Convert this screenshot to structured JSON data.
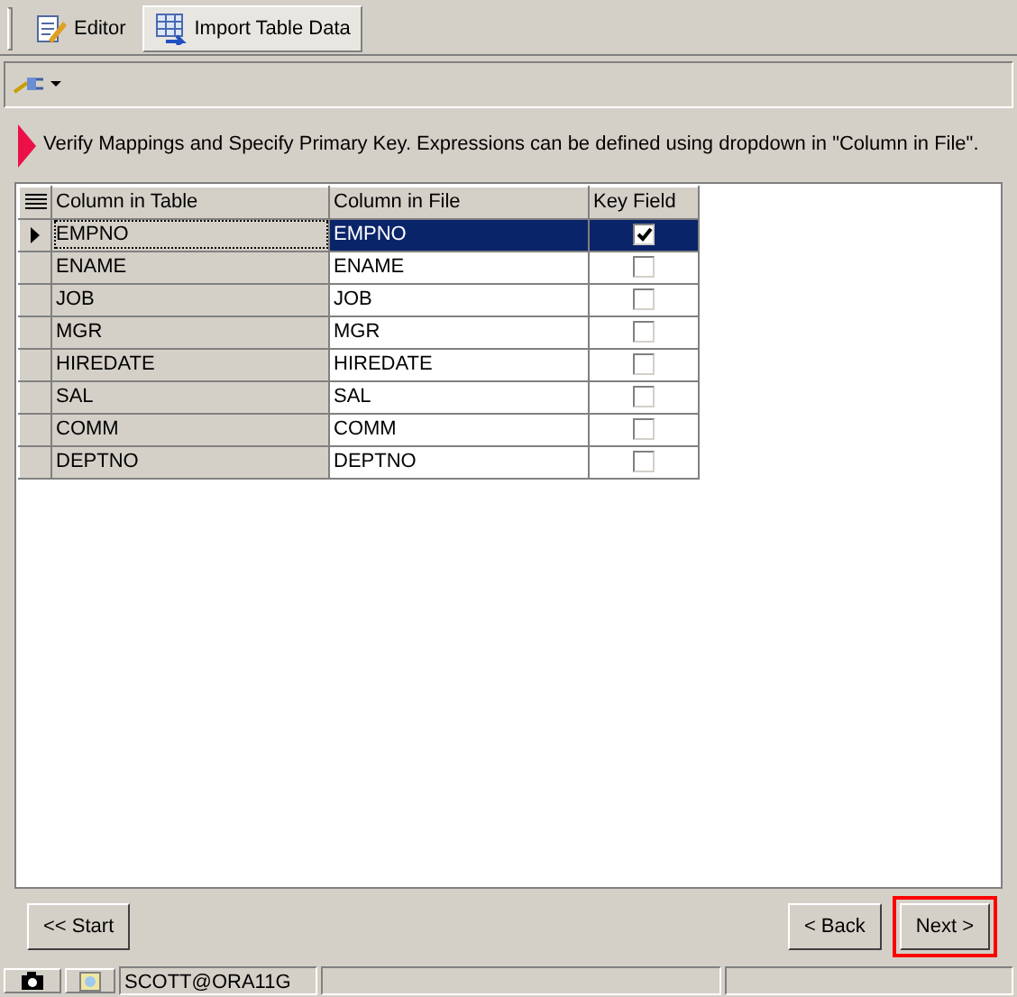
{
  "tabs": [
    {
      "label": "Editor",
      "selected": false
    },
    {
      "label": "Import Table Data",
      "selected": true
    }
  ],
  "message": "Verify Mappings and Specify Primary Key.  Expressions can be defined using dropdown in \"Column in File\".",
  "grid": {
    "columns": [
      "Column in Table",
      "Column in File",
      "Key Field"
    ],
    "rows": [
      {
        "column_in_table": "EMPNO",
        "column_in_file": "EMPNO",
        "key_field": true,
        "selected": true
      },
      {
        "column_in_table": "ENAME",
        "column_in_file": "ENAME",
        "key_field": false,
        "selected": false
      },
      {
        "column_in_table": "JOB",
        "column_in_file": "JOB",
        "key_field": false,
        "selected": false
      },
      {
        "column_in_table": "MGR",
        "column_in_file": "MGR",
        "key_field": false,
        "selected": false
      },
      {
        "column_in_table": "HIREDATE",
        "column_in_file": "HIREDATE",
        "key_field": false,
        "selected": false
      },
      {
        "column_in_table": "SAL",
        "column_in_file": "SAL",
        "key_field": false,
        "selected": false
      },
      {
        "column_in_table": "COMM",
        "column_in_file": "COMM",
        "key_field": false,
        "selected": false
      },
      {
        "column_in_table": "DEPTNO",
        "column_in_file": "DEPTNO",
        "key_field": false,
        "selected": false
      }
    ]
  },
  "buttons": [
    {
      "label": "<< Start",
      "highlighted": false
    },
    {
      "label": "< Back",
      "highlighted": false
    },
    {
      "label": "Next >",
      "highlighted": true
    }
  ],
  "status_bar": {
    "connection": "SCOTT@ORA11G"
  }
}
